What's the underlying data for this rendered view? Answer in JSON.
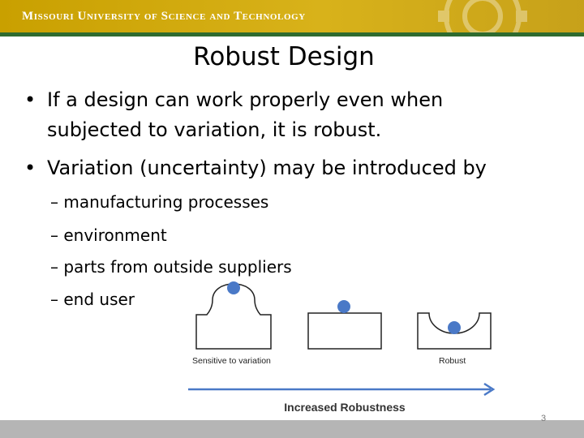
{
  "header": {
    "university": "Missouri University of Science and Technology",
    "brand_color": "#c9a000",
    "stripe_color": "#2f6b2f"
  },
  "slide": {
    "title": "Robust Design",
    "bullets": [
      {
        "line1": "If a design can work properly even when",
        "line2": "subjected to variation, it is robust."
      },
      {
        "text": "Variation (uncertainty) may be introduced by"
      }
    ],
    "subbullets": [
      "– manufacturing processes",
      "– environment",
      "– parts from outside suppliers",
      "– end user"
    ],
    "bullet_char": "•"
  },
  "diagram": {
    "label_left": "Sensitive to variation",
    "label_right": "Robust",
    "arrow_label": "Increased Robustness",
    "ball_color": "#4a79c7",
    "arrow_color": "#4a79c7"
  },
  "footer": {
    "page_number": "3"
  }
}
